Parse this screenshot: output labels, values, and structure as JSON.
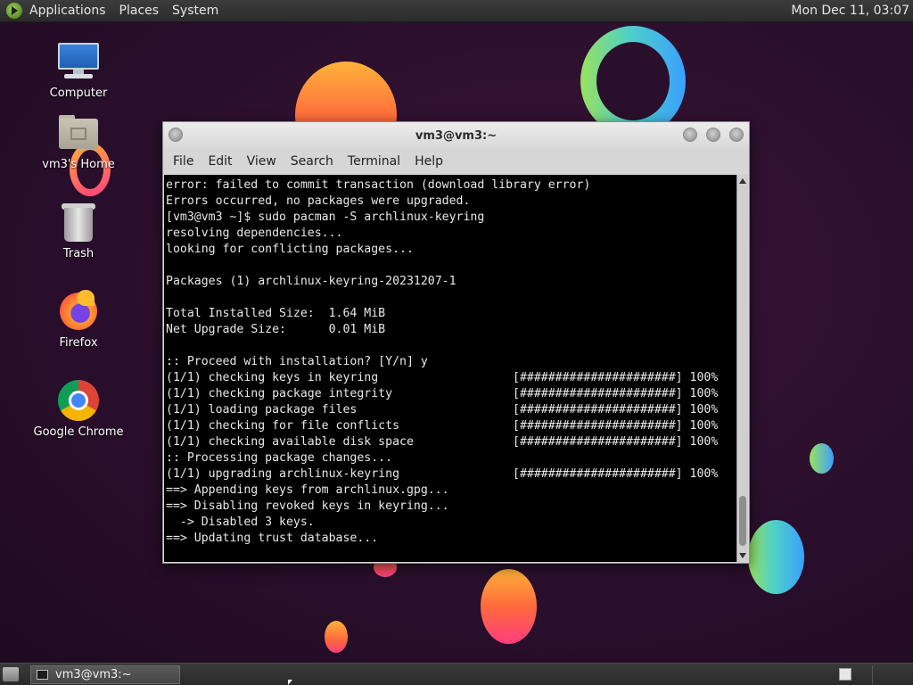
{
  "top_panel": {
    "menus": [
      "Applications",
      "Places",
      "System"
    ],
    "clock": "Mon Dec 11, 03:07"
  },
  "desktop": {
    "icons": [
      {
        "label": "Computer",
        "icon": "computer-icon"
      },
      {
        "label": "vm3's Home",
        "icon": "home-folder-icon"
      },
      {
        "label": "Trash",
        "icon": "trash-icon"
      },
      {
        "label": "Firefox",
        "icon": "firefox-icon"
      },
      {
        "label": "Google Chrome",
        "icon": "chrome-icon"
      }
    ]
  },
  "terminal_window": {
    "title": "vm3@vm3:~",
    "menus": [
      "File",
      "Edit",
      "View",
      "Search",
      "Terminal",
      "Help"
    ],
    "lines": [
      "error: failed to commit transaction (download library error)",
      "Errors occurred, no packages were upgraded.",
      "[vm3@vm3 ~]$ sudo pacman -S archlinux-keyring",
      "resolving dependencies...",
      "looking for conflicting packages...",
      "",
      "Packages (1) archlinux-keyring-20231207-1",
      "",
      "Total Installed Size:  1.64 MiB",
      "Net Upgrade Size:      0.01 MiB",
      "",
      ":: Proceed with installation? [Y/n] y",
      "(1/1) checking keys in keyring                   [######################] 100%",
      "(1/1) checking package integrity                 [######################] 100%",
      "(1/1) loading package files                      [######################] 100%",
      "(1/1) checking for file conflicts                [######################] 100%",
      "(1/1) checking available disk space              [######################] 100%",
      ":: Processing package changes...",
      "(1/1) upgrading archlinux-keyring                [######################] 100%",
      "==> Appending keys from archlinux.gpg...",
      "==> Disabling revoked keys in keyring...",
      "  -> Disabled 3 keys.",
      "==> Updating trust database..."
    ]
  },
  "bottom_panel": {
    "taskbar_item": "vm3@vm3:~"
  },
  "colors": {
    "wallpaper": "#2a0f2c",
    "terminal_bg": "#000000",
    "terminal_fg": "#e8e8e8",
    "panel": "#2b2b2b"
  }
}
